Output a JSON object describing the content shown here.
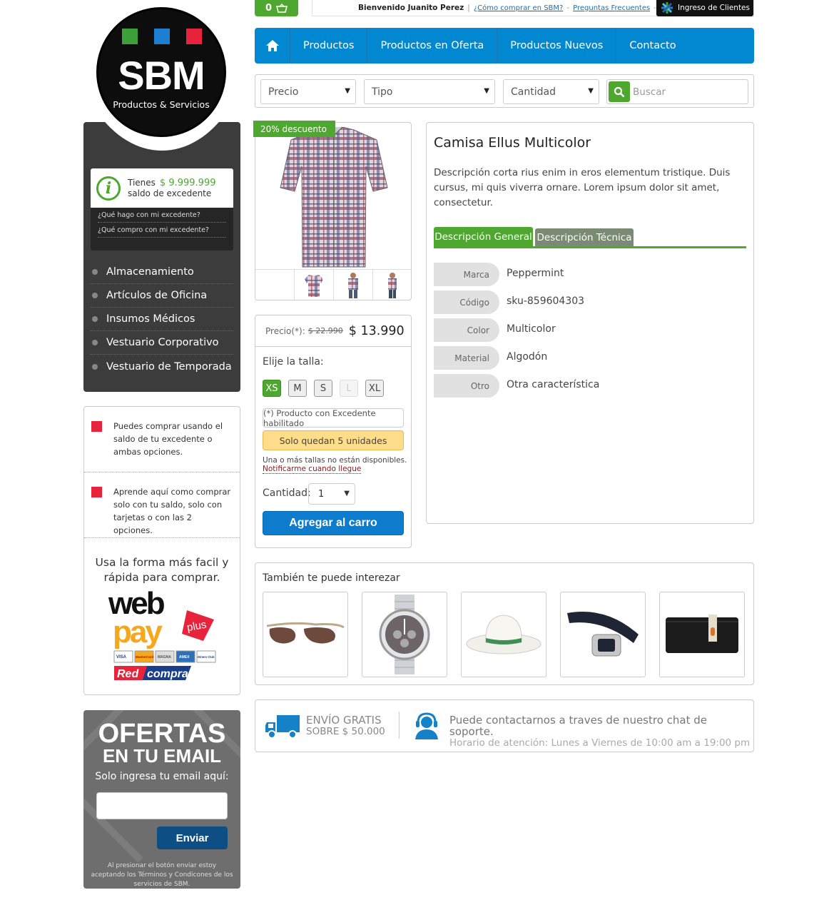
{
  "top": {
    "cart_count": "0",
    "welcome": "Bienvenido Juanito Perez",
    "link_how": "¿Cómo comprar en SBM?",
    "link_faq": "Preguntas Frecuentes",
    "login": "Ingreso de Clientes"
  },
  "logo": {
    "brand": "SBM",
    "tagline": "Productos & Servicios",
    "colors": [
      "#3da13a",
      "#1e7fd0",
      "#e8243c"
    ]
  },
  "balance": {
    "line1": "Tienes",
    "amount": "$ 9.999.999",
    "line2": "saldo de excedente",
    "q1": "¿Qué hago con mi excedente?",
    "q2": "¿Qué compro con mi excedente?"
  },
  "categories": [
    "Almacenamiento",
    "Artículos de Oficina",
    "Insumos Médicos",
    "Vestuario Corporativo",
    "Vestuario de Temporada"
  ],
  "info": {
    "tip1": "Puedes comprar usando el saldo de tu excedente o ambas opciones.",
    "tip2": "Aprende aquí como comprar solo con tu saldo, solo con tarjetas o con las 2 opciones.",
    "lead": "Usa la forma más facil y rápida para comprar.",
    "webpay_1": "web",
    "webpay_2": "pay",
    "webpay_plus": "plus",
    "cards": [
      "VISA",
      "MasterCard",
      "MAGNA",
      "AMEX",
      "Diners Club"
    ],
    "redcompra_1": "Red",
    "redcompra_2": "compra"
  },
  "newsletter": {
    "title1": "OFERTAS",
    "title2": "EN TU EMAIL",
    "prompt": "Solo ingresa tu email aquí:",
    "button": "Enviar",
    "legal": "Al presionar el botón enviar estoy aceptando los Términos y Condicones de los servicios de SBM."
  },
  "nav": [
    "Productos",
    "Productos en Oferta",
    "Productos Nuevos",
    "Contacto"
  ],
  "filters": {
    "price": "Precio",
    "type": "Tipo",
    "qty": "Cantidad",
    "search_placeholder": "Buscar"
  },
  "product": {
    "badge": "20% descuento",
    "price_label": "Precio(*):",
    "old_price": "$ 22.990",
    "new_price": "$ 13.990",
    "size_label": "Elije la talla:",
    "sizes": [
      "XS",
      "M",
      "S",
      "L",
      "XL"
    ],
    "excedente": "(*) Producto con Excedente habilitado",
    "units_left": "Solo quedan 5 unidades",
    "notice": "Una o más tallas no están disponibles.",
    "notify": "Notificarme cuando llegue",
    "qty_label": "Cantidad:",
    "qty_value": "1",
    "add_to_cart": "Agregar al carro",
    "title": "Camisa Ellus Multicolor",
    "description": "Descripción corta rius enim in eros elementum tristique. Duis cursus, mi quis viverra ornare. Lorem ipsum dolor sit amet, consectetur.",
    "tab1": "Descripción General",
    "tab2": "Descripción Técnica",
    "attributes": [
      {
        "k": "Marca",
        "v": "Peppermint"
      },
      {
        "k": "Código",
        "v": "sku-859604303"
      },
      {
        "k": "Color",
        "v": "Multicolor"
      },
      {
        "k": "Material",
        "v": "Algodón"
      },
      {
        "k": "Otro",
        "v": "Otra característica"
      }
    ]
  },
  "related": {
    "title": "También te puede interezar",
    "items": [
      "sunglasses-icon",
      "watch-icon",
      "hat-icon",
      "belt-icon",
      "wallet-icon"
    ]
  },
  "footer": {
    "ship1": "ENVÍO GRATIS",
    "ship2": "SOBRE $ 50.000",
    "support1": "Puede contactarnos a traves de nuestro chat de soporte.",
    "support2": "Horario de atención: Lunes a Viernes de 10:00 am a 19:00 pm"
  },
  "colors": {
    "green": "#4ea72e",
    "blue": "#0288d1",
    "dark": "#3c3c3c",
    "red": "#e8243c"
  }
}
